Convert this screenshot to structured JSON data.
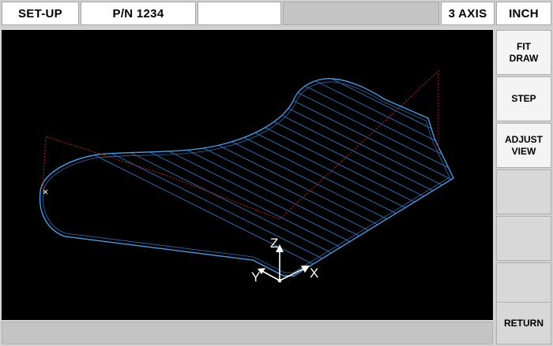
{
  "header": {
    "mode": "SET-UP",
    "part_number": "P/N 1234",
    "field3": "",
    "field4": "",
    "axes": "3 AXIS",
    "units": "INCH"
  },
  "softkeys": [
    {
      "label": "FIT\nDRAW"
    },
    {
      "label": "STEP"
    },
    {
      "label": "ADJUST\nVIEW"
    },
    {
      "label": ""
    },
    {
      "label": ""
    },
    {
      "label": ""
    },
    {
      "label": "RETURN"
    }
  ],
  "graphics": {
    "axis_labels": {
      "x": "X",
      "y": "Y",
      "z": "Z"
    },
    "colors": {
      "background": "#000000",
      "outline": "#4a98e0",
      "hatch": "#3a78c0",
      "toolpath": "#c02020",
      "axes": "#ffffff"
    }
  },
  "status": {
    "text": ""
  }
}
